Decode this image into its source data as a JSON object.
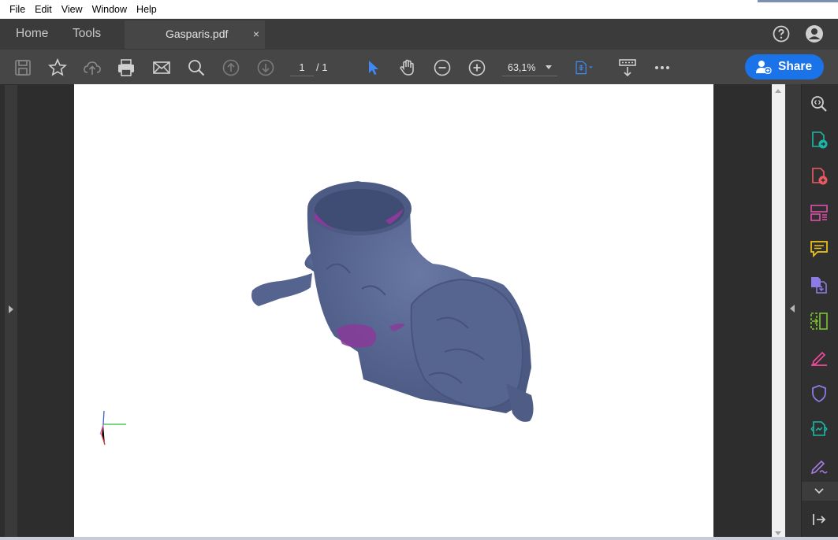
{
  "menu": [
    "File",
    "Edit",
    "View",
    "Window",
    "Help"
  ],
  "tabs": {
    "home": "Home",
    "tools": "Tools",
    "document": "Gasparis.pdf",
    "close": "×"
  },
  "toolbar": {
    "page_current": "1",
    "page_total": "/ 1",
    "zoom": "63,1%",
    "share_label": "Share"
  },
  "colors": {
    "accent": "#1a73e8",
    "model": "#5b6b94",
    "model_inner": "#8a3a9a",
    "panel_bg": "#303030",
    "toolbar_bg": "#464646"
  },
  "right_panel_tools": [
    "zoom-tool-icon",
    "export-pdf-icon",
    "create-pdf-icon",
    "organize-pages-icon",
    "comment-icon",
    "combine-files-icon",
    "compress-icon",
    "fill-sign-icon",
    "protect-icon",
    "scan-ocr-icon",
    "request-signature-icon"
  ]
}
